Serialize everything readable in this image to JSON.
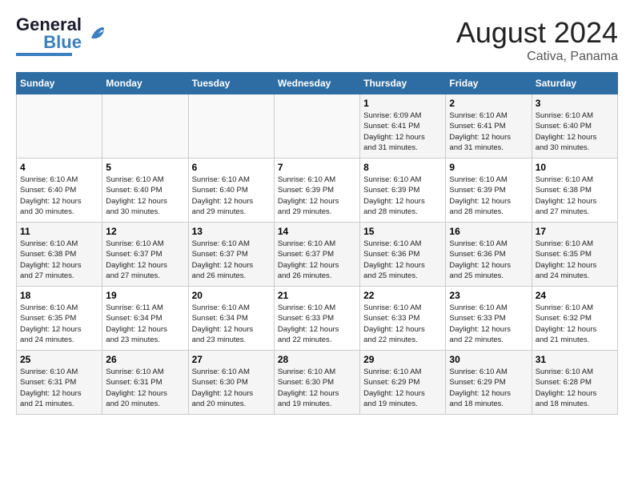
{
  "header": {
    "logo_line1": "General",
    "logo_line2": "Blue",
    "title": "August 2024",
    "subtitle": "Cativa, Panama"
  },
  "calendar": {
    "days_of_week": [
      "Sunday",
      "Monday",
      "Tuesday",
      "Wednesday",
      "Thursday",
      "Friday",
      "Saturday"
    ],
    "weeks": [
      [
        {
          "day": "",
          "info": ""
        },
        {
          "day": "",
          "info": ""
        },
        {
          "day": "",
          "info": ""
        },
        {
          "day": "",
          "info": ""
        },
        {
          "day": "1",
          "info": "Sunrise: 6:09 AM\nSunset: 6:41 PM\nDaylight: 12 hours\nand 31 minutes."
        },
        {
          "day": "2",
          "info": "Sunrise: 6:10 AM\nSunset: 6:41 PM\nDaylight: 12 hours\nand 31 minutes."
        },
        {
          "day": "3",
          "info": "Sunrise: 6:10 AM\nSunset: 6:40 PM\nDaylight: 12 hours\nand 30 minutes."
        }
      ],
      [
        {
          "day": "4",
          "info": "Sunrise: 6:10 AM\nSunset: 6:40 PM\nDaylight: 12 hours\nand 30 minutes."
        },
        {
          "day": "5",
          "info": "Sunrise: 6:10 AM\nSunset: 6:40 PM\nDaylight: 12 hours\nand 30 minutes."
        },
        {
          "day": "6",
          "info": "Sunrise: 6:10 AM\nSunset: 6:40 PM\nDaylight: 12 hours\nand 29 minutes."
        },
        {
          "day": "7",
          "info": "Sunrise: 6:10 AM\nSunset: 6:39 PM\nDaylight: 12 hours\nand 29 minutes."
        },
        {
          "day": "8",
          "info": "Sunrise: 6:10 AM\nSunset: 6:39 PM\nDaylight: 12 hours\nand 28 minutes."
        },
        {
          "day": "9",
          "info": "Sunrise: 6:10 AM\nSunset: 6:39 PM\nDaylight: 12 hours\nand 28 minutes."
        },
        {
          "day": "10",
          "info": "Sunrise: 6:10 AM\nSunset: 6:38 PM\nDaylight: 12 hours\nand 27 minutes."
        }
      ],
      [
        {
          "day": "11",
          "info": "Sunrise: 6:10 AM\nSunset: 6:38 PM\nDaylight: 12 hours\nand 27 minutes."
        },
        {
          "day": "12",
          "info": "Sunrise: 6:10 AM\nSunset: 6:37 PM\nDaylight: 12 hours\nand 27 minutes."
        },
        {
          "day": "13",
          "info": "Sunrise: 6:10 AM\nSunset: 6:37 PM\nDaylight: 12 hours\nand 26 minutes."
        },
        {
          "day": "14",
          "info": "Sunrise: 6:10 AM\nSunset: 6:37 PM\nDaylight: 12 hours\nand 26 minutes."
        },
        {
          "day": "15",
          "info": "Sunrise: 6:10 AM\nSunset: 6:36 PM\nDaylight: 12 hours\nand 25 minutes."
        },
        {
          "day": "16",
          "info": "Sunrise: 6:10 AM\nSunset: 6:36 PM\nDaylight: 12 hours\nand 25 minutes."
        },
        {
          "day": "17",
          "info": "Sunrise: 6:10 AM\nSunset: 6:35 PM\nDaylight: 12 hours\nand 24 minutes."
        }
      ],
      [
        {
          "day": "18",
          "info": "Sunrise: 6:10 AM\nSunset: 6:35 PM\nDaylight: 12 hours\nand 24 minutes."
        },
        {
          "day": "19",
          "info": "Sunrise: 6:11 AM\nSunset: 6:34 PM\nDaylight: 12 hours\nand 23 minutes."
        },
        {
          "day": "20",
          "info": "Sunrise: 6:10 AM\nSunset: 6:34 PM\nDaylight: 12 hours\nand 23 minutes."
        },
        {
          "day": "21",
          "info": "Sunrise: 6:10 AM\nSunset: 6:33 PM\nDaylight: 12 hours\nand 22 minutes."
        },
        {
          "day": "22",
          "info": "Sunrise: 6:10 AM\nSunset: 6:33 PM\nDaylight: 12 hours\nand 22 minutes."
        },
        {
          "day": "23",
          "info": "Sunrise: 6:10 AM\nSunset: 6:33 PM\nDaylight: 12 hours\nand 22 minutes."
        },
        {
          "day": "24",
          "info": "Sunrise: 6:10 AM\nSunset: 6:32 PM\nDaylight: 12 hours\nand 21 minutes."
        }
      ],
      [
        {
          "day": "25",
          "info": "Sunrise: 6:10 AM\nSunset: 6:31 PM\nDaylight: 12 hours\nand 21 minutes."
        },
        {
          "day": "26",
          "info": "Sunrise: 6:10 AM\nSunset: 6:31 PM\nDaylight: 12 hours\nand 20 minutes."
        },
        {
          "day": "27",
          "info": "Sunrise: 6:10 AM\nSunset: 6:30 PM\nDaylight: 12 hours\nand 20 minutes."
        },
        {
          "day": "28",
          "info": "Sunrise: 6:10 AM\nSunset: 6:30 PM\nDaylight: 12 hours\nand 19 minutes."
        },
        {
          "day": "29",
          "info": "Sunrise: 6:10 AM\nSunset: 6:29 PM\nDaylight: 12 hours\nand 19 minutes."
        },
        {
          "day": "30",
          "info": "Sunrise: 6:10 AM\nSunset: 6:29 PM\nDaylight: 12 hours\nand 18 minutes."
        },
        {
          "day": "31",
          "info": "Sunrise: 6:10 AM\nSunset: 6:28 PM\nDaylight: 12 hours\nand 18 minutes."
        }
      ]
    ]
  }
}
